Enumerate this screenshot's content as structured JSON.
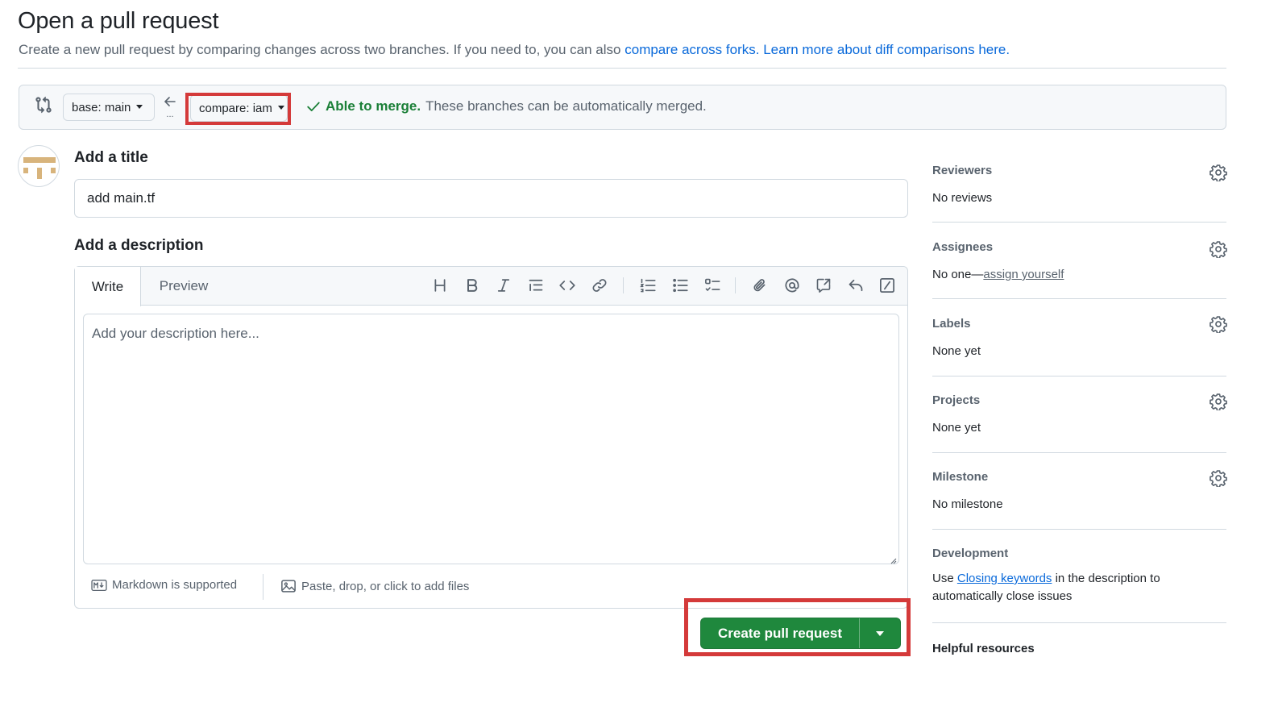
{
  "header": {
    "title": "Open a pull request",
    "subtitle_prefix": "Create a new pull request by comparing changes across two branches. If you need to, you can also",
    "compare_forks_link": "compare across forks.",
    "learn_more_link": "Learn more about diff comparisons here."
  },
  "compare_bar": {
    "base_label": "base: main",
    "compare_label": "compare: iam",
    "merge_ok": "Able to merge.",
    "merge_text": "These branches can be automatically merged.",
    "arrow_dots": "..."
  },
  "form": {
    "title_label": "Add a title",
    "title_value": "add main.tf",
    "description_label": "Add a description",
    "tab_write": "Write",
    "tab_preview": "Preview",
    "description_placeholder": "Add your description here...",
    "markdown_note": "Markdown is supported",
    "attach_note": "Paste, drop, or click to add files",
    "create_button": "Create pull request"
  },
  "sidebar": {
    "reviewers": {
      "title": "Reviewers",
      "value": "No reviews"
    },
    "assignees": {
      "title": "Assignees",
      "value_prefix": "No one—",
      "value_link": "assign yourself"
    },
    "labels": {
      "title": "Labels",
      "value": "None yet"
    },
    "projects": {
      "title": "Projects",
      "value": "None yet"
    },
    "milestone": {
      "title": "Milestone",
      "value": "No milestone"
    },
    "development": {
      "title": "Development",
      "value_prefix": "Use",
      "value_link": "Closing keywords",
      "value_suffix": "in the description to automatically close issues"
    },
    "helpful": {
      "title": "Helpful resources"
    }
  },
  "colors": {
    "accent_link": "#0969da",
    "success_green": "#1a7f37",
    "button_green": "#1f883d",
    "highlight_red": "#d43a3a",
    "avatar_tan": "#d8b47c"
  },
  "toolbar_icons": [
    "heading-icon",
    "bold-icon",
    "italic-icon",
    "quote-icon",
    "code-icon",
    "link-icon",
    "ordered-list-icon",
    "unordered-list-icon",
    "task-list-icon",
    "attach-icon",
    "mention-icon",
    "cross-reference-icon",
    "reply-icon",
    "slash-commands-icon"
  ]
}
